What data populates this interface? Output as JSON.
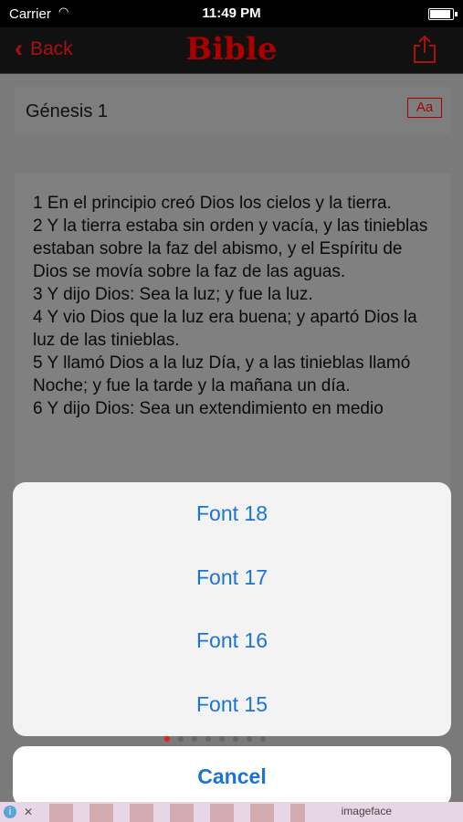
{
  "status_bar": {
    "carrier": "Carrier",
    "time": "11:49 PM"
  },
  "nav": {
    "back_label": "Back",
    "title": "Bible",
    "title_color": "#aa0000"
  },
  "chapter": {
    "title": "Génesis 1",
    "font_button": "Aa"
  },
  "verses": [
    "1 En el principio creó Dios los cielos y la tierra.",
    "2 Y la tierra estaba sin orden y vacía, y las tinieblas estaban sobre la faz del abismo, y el Espíritu de Dios se movía sobre la faz de las aguas.",
    "3 Y dijo Dios: Sea la luz; y fue la luz.",
    "4 Y vio Dios que la luz era buena; y apartó Dios la luz de las tinieblas.",
    "5 Y llamó Dios a la luz Día, y a las tinieblas llamó Noche; y fue la tarde y la mañana un día.",
    "6 Y dijo Dios: Sea un extendimiento en medio"
  ],
  "action_sheet": {
    "options": [
      "Font 18",
      "Font 17",
      "Font 16",
      "Font 15"
    ],
    "cancel_label": "Cancel",
    "accent_color": "#1a73d9"
  },
  "ad": {
    "brand": "imageface"
  }
}
